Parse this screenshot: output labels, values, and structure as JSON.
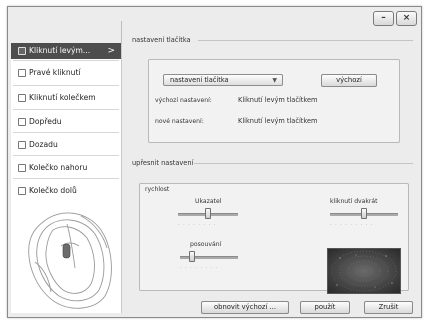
{
  "window": {
    "minimize_label": "–",
    "close_label": "×"
  },
  "sidebar": {
    "items": [
      {
        "label": "Kliknutí levým...",
        "active": true,
        "arrow": ">"
      },
      {
        "label": "Pravé kliknutí"
      },
      {
        "label": "Kliknutí kolečkem"
      },
      {
        "label": "Dopředu"
      },
      {
        "label": "Dozadu"
      },
      {
        "label": "Kolečko nahoru"
      },
      {
        "label": "Kolečko dolů"
      }
    ]
  },
  "button_section": {
    "title": "nastavení tlačítka",
    "combo_value": "nastavení tlačítka",
    "default_button": "výchozí",
    "default_setting_label": "výchozí nastavení:",
    "default_setting_value": "Kliknutí levým tlačítkem",
    "new_setting_label": "nové nastavení:",
    "new_setting_value": "Kliknutí levým tlačítkem"
  },
  "refine_section": {
    "title": "upřesnit nastavení",
    "speed_label": "rychlost",
    "pointer_label": "Ukazatel",
    "pointer_level": 0.5,
    "double_click_label": "kliknutí dvakrát",
    "double_click_level": 0.5,
    "scroll_label": "posouvání",
    "scroll_level": 0.2
  },
  "footer": {
    "restore_defaults": "obnovit  výchozí ...",
    "apply": "použít",
    "cancel": "Zrušit"
  },
  "colors": {
    "active_nav_bg": "#4d4d4d",
    "window_bg": "#ececec"
  }
}
